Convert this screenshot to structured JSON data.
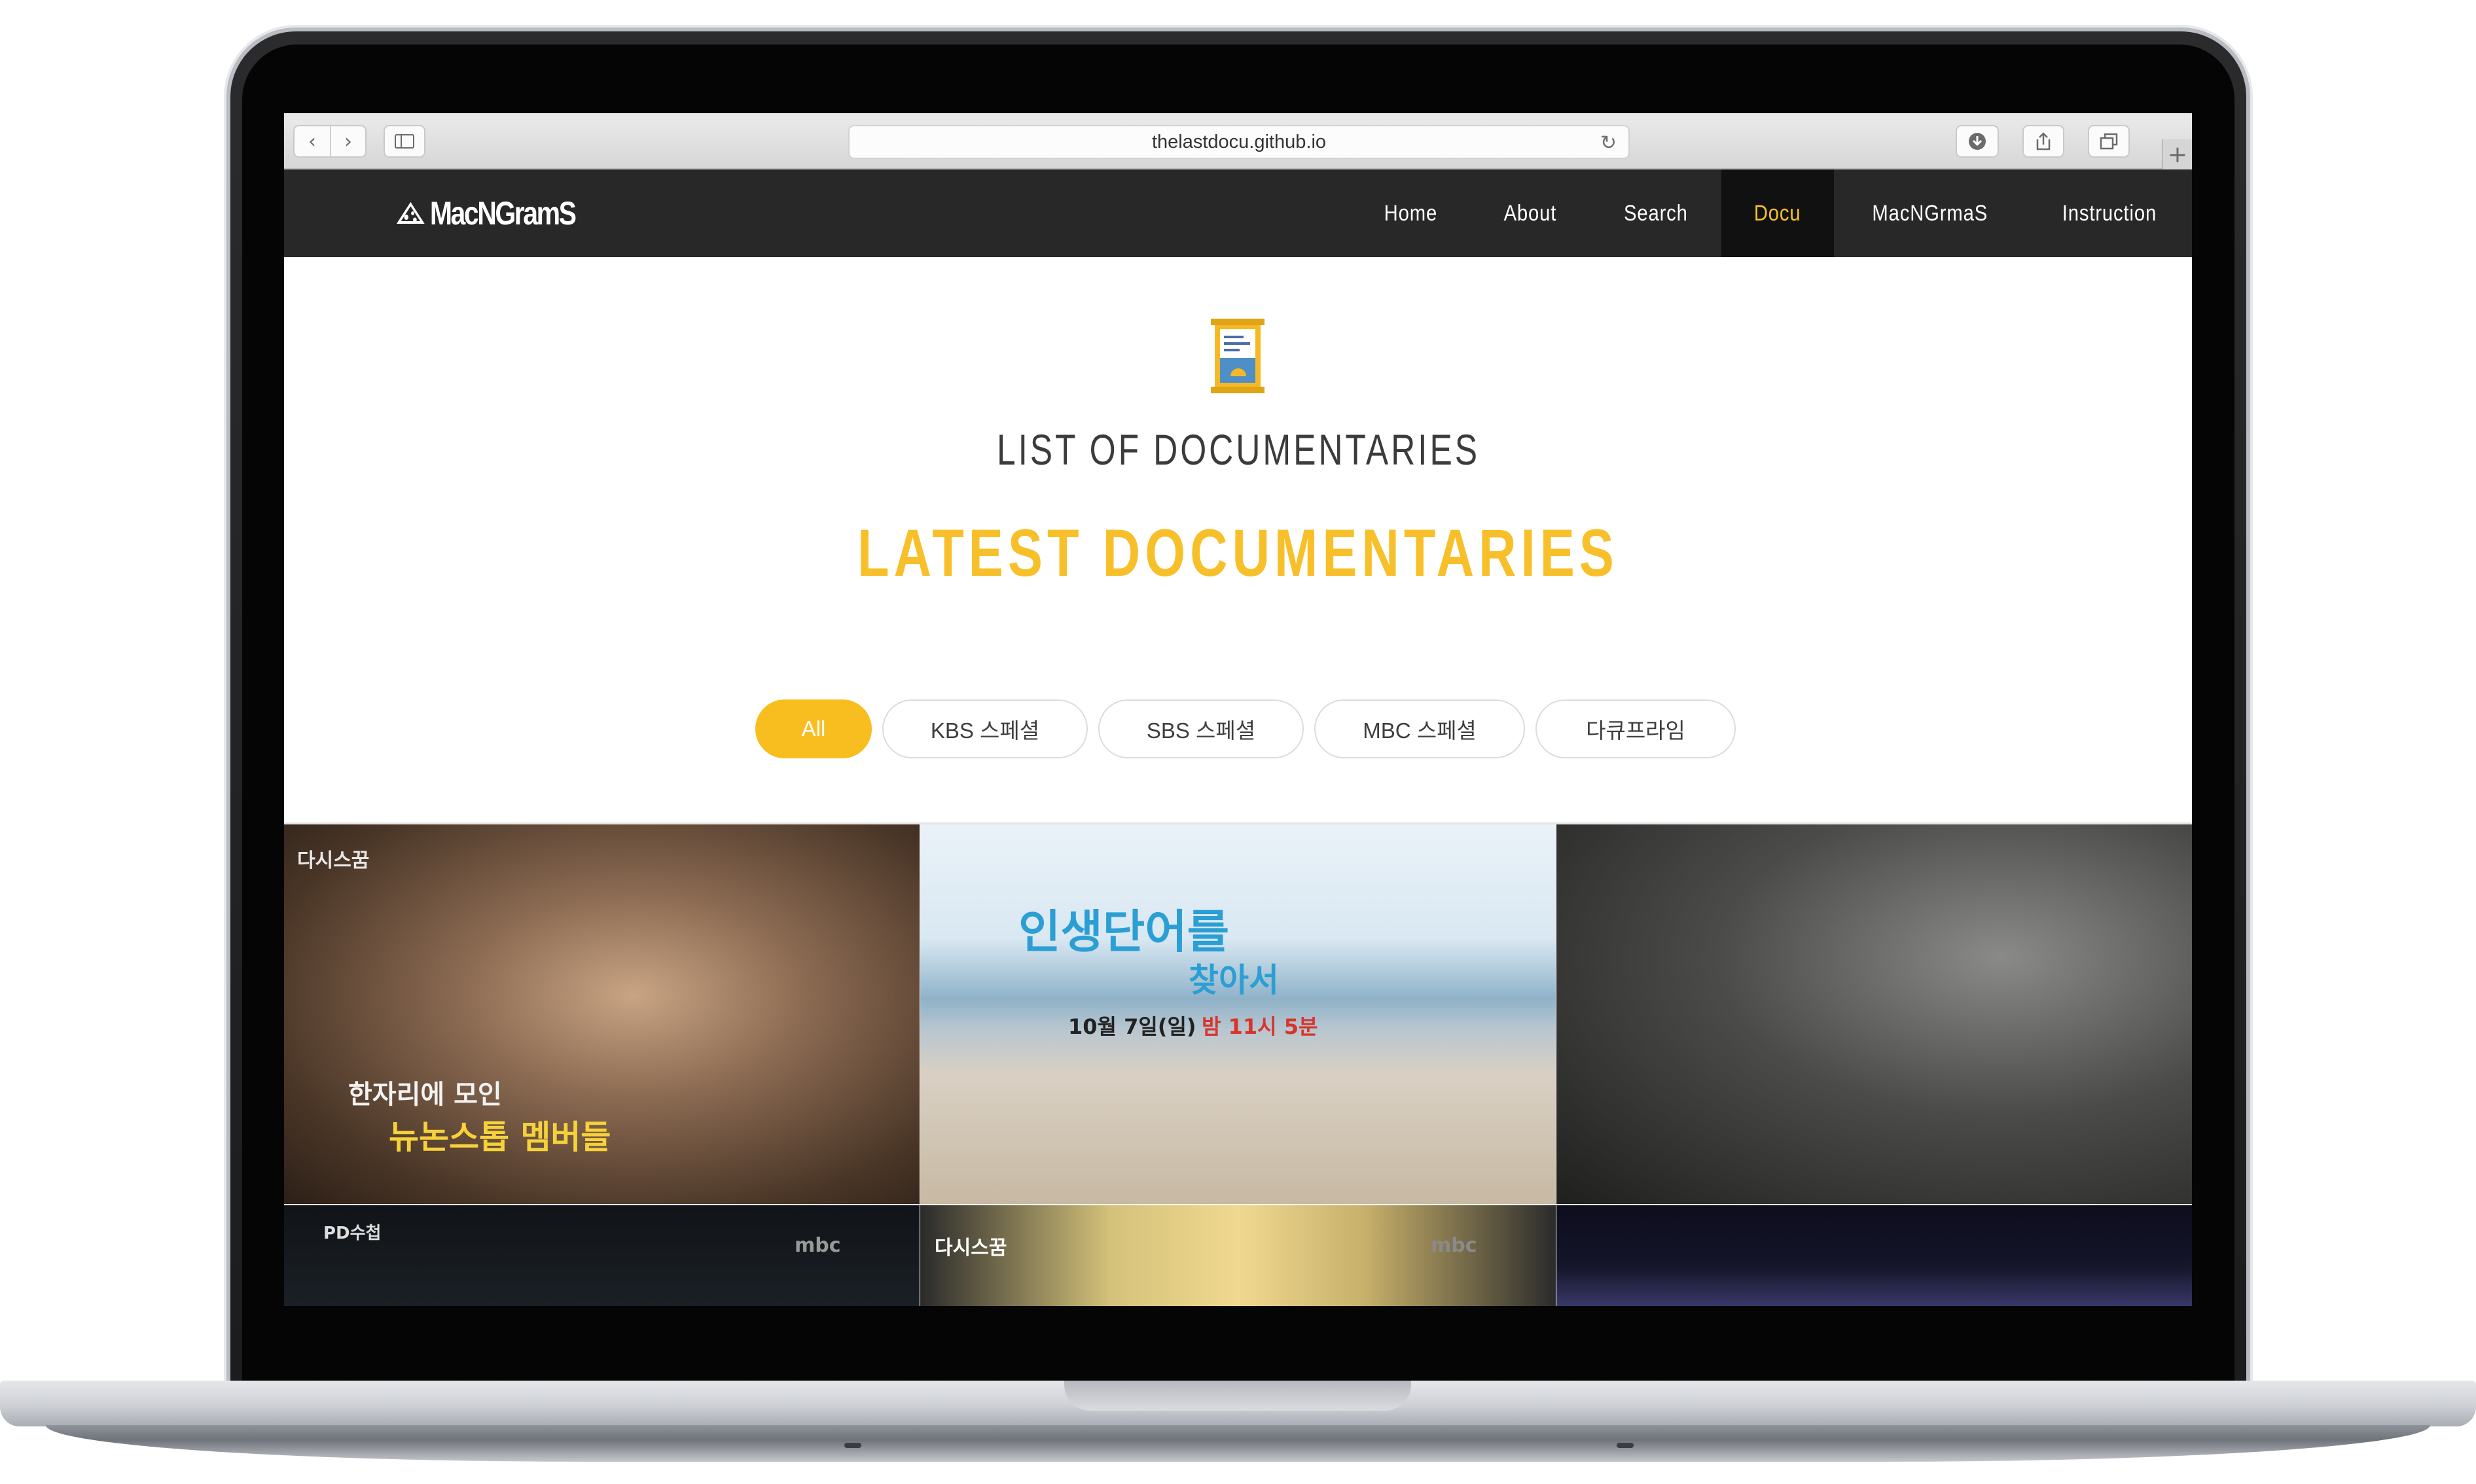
{
  "browser": {
    "url": "thelastdocu.github.io"
  },
  "site": {
    "logo_text": "MacNGramS",
    "menu": [
      {
        "label": "Home",
        "active": false
      },
      {
        "label": "About",
        "active": false
      },
      {
        "label": "Search",
        "active": false
      },
      {
        "label": "Docu",
        "active": true
      },
      {
        "label": "MacNGrmaS",
        "active": false
      },
      {
        "label": "Instruction",
        "active": false
      }
    ]
  },
  "hero": {
    "icon": "document-icon",
    "subtitle": "LIST OF DOCUMENTARIES",
    "title": "LATEST DOCUMENTARIES"
  },
  "filters": [
    {
      "label": "All",
      "active": true
    },
    {
      "label": "KBS 스페셜",
      "active": false
    },
    {
      "label": "SBS 스페셜",
      "active": false
    },
    {
      "label": "MBC 스페셜",
      "active": false
    },
    {
      "label": "다큐프라임",
      "active": false
    }
  ],
  "tiles": [
    {
      "caption_1": "한자리에 모인",
      "caption_2": "뉴논스톱 멤버들",
      "badge": "다시스꿈"
    },
    {
      "caption_1": "인생단어를",
      "caption_2": "찾아서",
      "caption_3": "10월 7일(일)",
      "caption_4": "밤 11시 5분"
    },
    {
      "caption_1": "",
      "caption_2": ""
    },
    {
      "caption_1": "PD수첩",
      "caption_2": "mbc"
    },
    {
      "caption_1": "다시스꿈",
      "caption_2": "mbc"
    },
    {
      "caption_1": "",
      "caption_2": ""
    }
  ],
  "colors": {
    "accent": "#f8bd1f",
    "nav_bg": "#282828",
    "nav_active_bg": "#111111"
  }
}
